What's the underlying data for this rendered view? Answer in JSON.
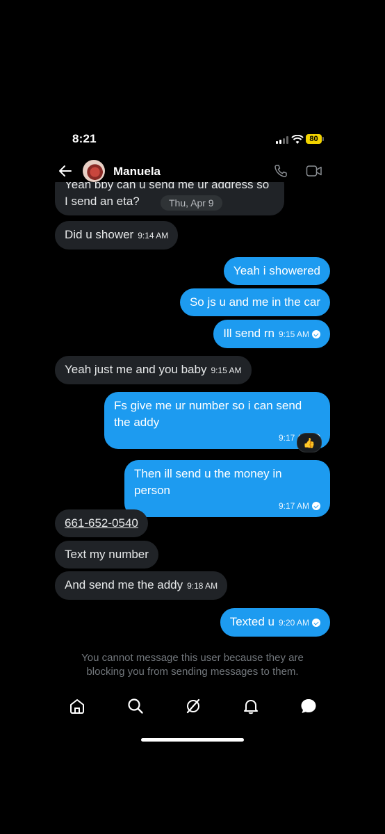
{
  "status_bar": {
    "time": "8:21",
    "battery": "80"
  },
  "header": {
    "contact_name": "Manuela"
  },
  "messages": [
    {
      "dir": "in",
      "text": "Yeah bby can u send me ur address so I send an eta?",
      "date_separator": "Thu, Apr 9"
    },
    {
      "dir": "in",
      "text": "Did u shower",
      "time": "9:14 AM"
    },
    {
      "dir": "out",
      "text": "Yeah i showered"
    },
    {
      "dir": "out",
      "text": "So js u and me in the car"
    },
    {
      "dir": "out",
      "text": "Ill send rn",
      "time": "9:15 AM"
    },
    {
      "dir": "in",
      "text": "Yeah just me and you baby",
      "time": "9:15 AM"
    },
    {
      "dir": "out",
      "text": "Fs give me ur number so i can send the addy",
      "time": "9:17 AM",
      "reaction": "👍"
    },
    {
      "dir": "out",
      "text": "Then ill send u the money in person",
      "time": "9:17 AM"
    },
    {
      "dir": "in",
      "text": "661-652-0540",
      "link": true
    },
    {
      "dir": "in",
      "text": "Text my number"
    },
    {
      "dir": "in",
      "text": "And send me the addy",
      "time": "9:18 AM"
    },
    {
      "dir": "out",
      "text": "Texted u",
      "time": "9:20 AM"
    }
  ],
  "notice": "You cannot message this user because they are blocking you from sending messages to them.",
  "tab_bar": {
    "items": [
      "home-icon",
      "search-icon",
      "grok-icon",
      "bell-icon",
      "messages-icon"
    ]
  },
  "colors": {
    "outgoing": "#1d9bf0",
    "incoming": "#202327",
    "background": "#000000"
  }
}
